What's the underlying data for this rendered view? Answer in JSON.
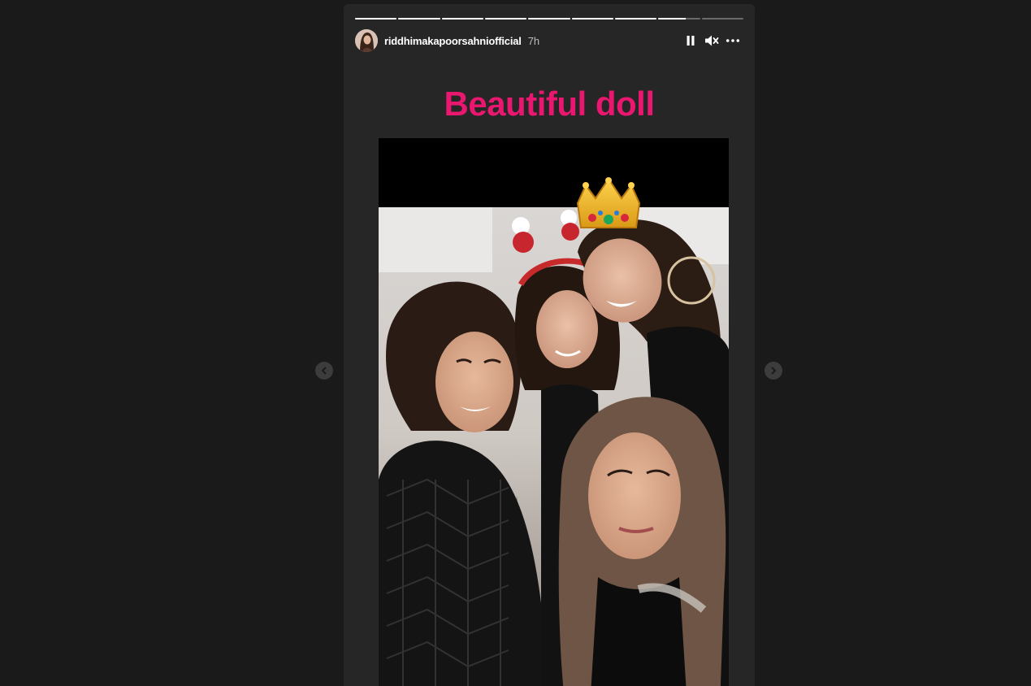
{
  "story": {
    "username": "riddhimakapoorsahniofficial",
    "time": "7h",
    "caption": "Beautiful doll",
    "caption_color": "#e9176f",
    "progress": {
      "total_segments": 9,
      "current_segment": 8,
      "current_fraction": 0.65
    }
  },
  "controls": {
    "pause_icon": "pause-icon",
    "mute_icon": "muted-speaker-icon",
    "more_icon": "more-options-icon"
  },
  "navigation": {
    "prev_icon": "chevron-left-icon",
    "next_icon": "chevron-right-icon"
  },
  "photo": {
    "sticker": "crown-emoji"
  }
}
